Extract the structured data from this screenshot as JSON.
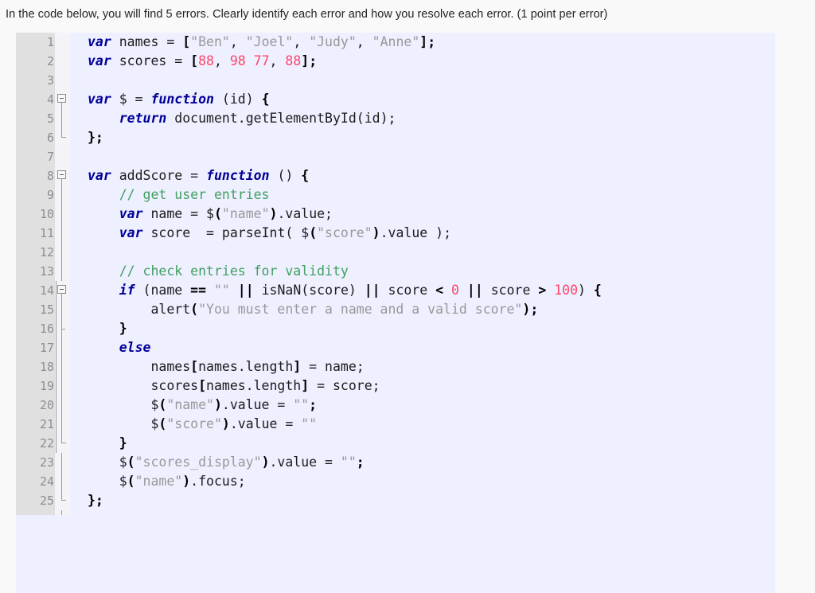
{
  "question": {
    "prompt": "In the code below, you will find 5 errors. Clearly identify each error and how you resolve each error. (1 point per error)",
    "error_count": "5",
    "points_per_error": "1 point per error"
  },
  "colors": {
    "page_background": "#f9f9f9",
    "code_background": "#eeefff",
    "gutter_background": "#e0e0e0",
    "fold_strip_background": "#f4f4f8",
    "line_number": "#8d8d93",
    "keyword": "#000099",
    "string": "#999999",
    "number": "#ff4466",
    "comment": "#3f9f5f",
    "text": "#1c1c1c"
  },
  "editor": {
    "first_line": "1",
    "last_line": "25",
    "language": "JavaScript",
    "lines": [
      {
        "num": "1",
        "fold": "none",
        "tokens": [
          {
            "t": "var",
            "c": "kw"
          },
          {
            "t": " names = ",
            "c": "plain"
          },
          {
            "t": "[",
            "c": "punct"
          },
          {
            "t": "\"Ben\"",
            "c": "str"
          },
          {
            "t": ", ",
            "c": "plain"
          },
          {
            "t": "\"Joel\"",
            "c": "str"
          },
          {
            "t": ", ",
            "c": "plain"
          },
          {
            "t": "\"Judy\"",
            "c": "str"
          },
          {
            "t": ", ",
            "c": "plain"
          },
          {
            "t": "\"Anne\"",
            "c": "str"
          },
          {
            "t": "];",
            "c": "punct"
          }
        ]
      },
      {
        "num": "2",
        "fold": "none",
        "tokens": [
          {
            "t": "var",
            "c": "kw"
          },
          {
            "t": " scores = ",
            "c": "plain"
          },
          {
            "t": "[",
            "c": "punct"
          },
          {
            "t": "88",
            "c": "num"
          },
          {
            "t": ", ",
            "c": "plain"
          },
          {
            "t": "98",
            "c": "num"
          },
          {
            "t": " ",
            "c": "plain"
          },
          {
            "t": "77",
            "c": "num"
          },
          {
            "t": ", ",
            "c": "plain"
          },
          {
            "t": "88",
            "c": "num"
          },
          {
            "t": "];",
            "c": "punct"
          }
        ]
      },
      {
        "num": "3",
        "fold": "none",
        "tokens": []
      },
      {
        "num": "4",
        "fold": "box",
        "tokens": [
          {
            "t": "var",
            "c": "kw"
          },
          {
            "t": " $ = ",
            "c": "plain"
          },
          {
            "t": "function",
            "c": "kw"
          },
          {
            "t": " (id) ",
            "c": "plain"
          },
          {
            "t": "{",
            "c": "punct"
          }
        ]
      },
      {
        "num": "5",
        "fold": "line",
        "tokens": [
          {
            "t": "    ",
            "c": "plain"
          },
          {
            "t": "return",
            "c": "kw"
          },
          {
            "t": " document.getElementById(id);",
            "c": "plain"
          }
        ]
      },
      {
        "num": "6",
        "fold": "end",
        "tokens": [
          {
            "t": "};",
            "c": "punct"
          }
        ]
      },
      {
        "num": "7",
        "fold": "none",
        "tokens": []
      },
      {
        "num": "8",
        "fold": "box",
        "tokens": [
          {
            "t": "var",
            "c": "kw"
          },
          {
            "t": " addScore = ",
            "c": "plain"
          },
          {
            "t": "function",
            "c": "kw"
          },
          {
            "t": " () ",
            "c": "plain"
          },
          {
            "t": "{",
            "c": "punct"
          }
        ]
      },
      {
        "num": "9",
        "fold": "line",
        "tokens": [
          {
            "t": "    ",
            "c": "plain"
          },
          {
            "t": "// get user entries",
            "c": "com"
          }
        ]
      },
      {
        "num": "10",
        "fold": "line",
        "tokens": [
          {
            "t": "    ",
            "c": "plain"
          },
          {
            "t": "var",
            "c": "kw"
          },
          {
            "t": " name = $",
            "c": "plain"
          },
          {
            "t": "(",
            "c": "punct"
          },
          {
            "t": "\"name\"",
            "c": "str"
          },
          {
            "t": ")",
            "c": "punct"
          },
          {
            "t": ".value;",
            "c": "plain"
          }
        ]
      },
      {
        "num": "11",
        "fold": "line",
        "tokens": [
          {
            "t": "    ",
            "c": "plain"
          },
          {
            "t": "var",
            "c": "kw"
          },
          {
            "t": " score  = parseInt( $",
            "c": "plain"
          },
          {
            "t": "(",
            "c": "punct"
          },
          {
            "t": "\"score\"",
            "c": "str"
          },
          {
            "t": ")",
            "c": "punct"
          },
          {
            "t": ".value );",
            "c": "plain"
          }
        ]
      },
      {
        "num": "12",
        "fold": "line",
        "tokens": []
      },
      {
        "num": "13",
        "fold": "line",
        "tokens": [
          {
            "t": "    ",
            "c": "plain"
          },
          {
            "t": "// check entries for validity",
            "c": "com"
          }
        ]
      },
      {
        "num": "14",
        "fold": "box-inner",
        "tokens": [
          {
            "t": "    ",
            "c": "plain"
          },
          {
            "t": "if",
            "c": "kw"
          },
          {
            "t": " (name ",
            "c": "plain"
          },
          {
            "t": "==",
            "c": "punct"
          },
          {
            "t": " ",
            "c": "plain"
          },
          {
            "t": "\"\"",
            "c": "str"
          },
          {
            "t": " ",
            "c": "plain"
          },
          {
            "t": "||",
            "c": "punct"
          },
          {
            "t": " isNaN(score) ",
            "c": "plain"
          },
          {
            "t": "||",
            "c": "punct"
          },
          {
            "t": " score ",
            "c": "plain"
          },
          {
            "t": "<",
            "c": "punct"
          },
          {
            "t": " ",
            "c": "plain"
          },
          {
            "t": "0",
            "c": "num"
          },
          {
            "t": " ",
            "c": "plain"
          },
          {
            "t": "||",
            "c": "punct"
          },
          {
            "t": " score ",
            "c": "plain"
          },
          {
            "t": ">",
            "c": "punct"
          },
          {
            "t": " ",
            "c": "plain"
          },
          {
            "t": "100",
            "c": "num"
          },
          {
            "t": ") ",
            "c": "plain"
          },
          {
            "t": "{",
            "c": "punct"
          }
        ]
      },
      {
        "num": "15",
        "fold": "line-inner",
        "tokens": [
          {
            "t": "        alert",
            "c": "plain"
          },
          {
            "t": "(",
            "c": "punct"
          },
          {
            "t": "\"You must enter a name and a valid score\"",
            "c": "str"
          },
          {
            "t": ")",
            "c": "punct"
          },
          {
            "t": ";",
            "c": "punct"
          }
        ]
      },
      {
        "num": "16",
        "fold": "tick-inner",
        "tokens": [
          {
            "t": "    ",
            "c": "plain"
          },
          {
            "t": "}",
            "c": "punct"
          }
        ]
      },
      {
        "num": "17",
        "fold": "line-inner",
        "tokens": [
          {
            "t": "    ",
            "c": "plain"
          },
          {
            "t": "else",
            "c": "kw"
          }
        ]
      },
      {
        "num": "18",
        "fold": "line-inner",
        "tokens": [
          {
            "t": "        names",
            "c": "plain"
          },
          {
            "t": "[",
            "c": "punct"
          },
          {
            "t": "names.length",
            "c": "plain"
          },
          {
            "t": "]",
            "c": "punct"
          },
          {
            "t": " = name;",
            "c": "plain"
          }
        ]
      },
      {
        "num": "19",
        "fold": "line-inner",
        "tokens": [
          {
            "t": "        scores",
            "c": "plain"
          },
          {
            "t": "[",
            "c": "punct"
          },
          {
            "t": "names.length",
            "c": "plain"
          },
          {
            "t": "]",
            "c": "punct"
          },
          {
            "t": " = score;",
            "c": "plain"
          }
        ]
      },
      {
        "num": "20",
        "fold": "line-inner",
        "tokens": [
          {
            "t": "        $",
            "c": "plain"
          },
          {
            "t": "(",
            "c": "punct"
          },
          {
            "t": "\"name\"",
            "c": "str"
          },
          {
            "t": ")",
            "c": "punct"
          },
          {
            "t": ".value = ",
            "c": "plain"
          },
          {
            "t": "\"\"",
            "c": "str"
          },
          {
            "t": ";",
            "c": "punct"
          }
        ]
      },
      {
        "num": "21",
        "fold": "line-inner",
        "tokens": [
          {
            "t": "        $",
            "c": "plain"
          },
          {
            "t": "(",
            "c": "punct"
          },
          {
            "t": "\"score\"",
            "c": "str"
          },
          {
            "t": ")",
            "c": "punct"
          },
          {
            "t": ".value = ",
            "c": "plain"
          },
          {
            "t": "\"\"",
            "c": "str"
          }
        ]
      },
      {
        "num": "22",
        "fold": "end-inner",
        "tokens": [
          {
            "t": "    ",
            "c": "plain"
          },
          {
            "t": "}",
            "c": "punct"
          }
        ]
      },
      {
        "num": "23",
        "fold": "line",
        "tokens": [
          {
            "t": "    $",
            "c": "plain"
          },
          {
            "t": "(",
            "c": "punct"
          },
          {
            "t": "\"scores_display\"",
            "c": "str"
          },
          {
            "t": ")",
            "c": "punct"
          },
          {
            "t": ".value = ",
            "c": "plain"
          },
          {
            "t": "\"\"",
            "c": "str"
          },
          {
            "t": ";",
            "c": "punct"
          }
        ]
      },
      {
        "num": "24",
        "fold": "line",
        "tokens": [
          {
            "t": "    $",
            "c": "plain"
          },
          {
            "t": "(",
            "c": "punct"
          },
          {
            "t": "\"name\"",
            "c": "str"
          },
          {
            "t": ")",
            "c": "punct"
          },
          {
            "t": ".focus;",
            "c": "plain"
          }
        ]
      },
      {
        "num": "25",
        "fold": "end",
        "tokens": [
          {
            "t": "};",
            "c": "punct"
          }
        ]
      }
    ]
  }
}
